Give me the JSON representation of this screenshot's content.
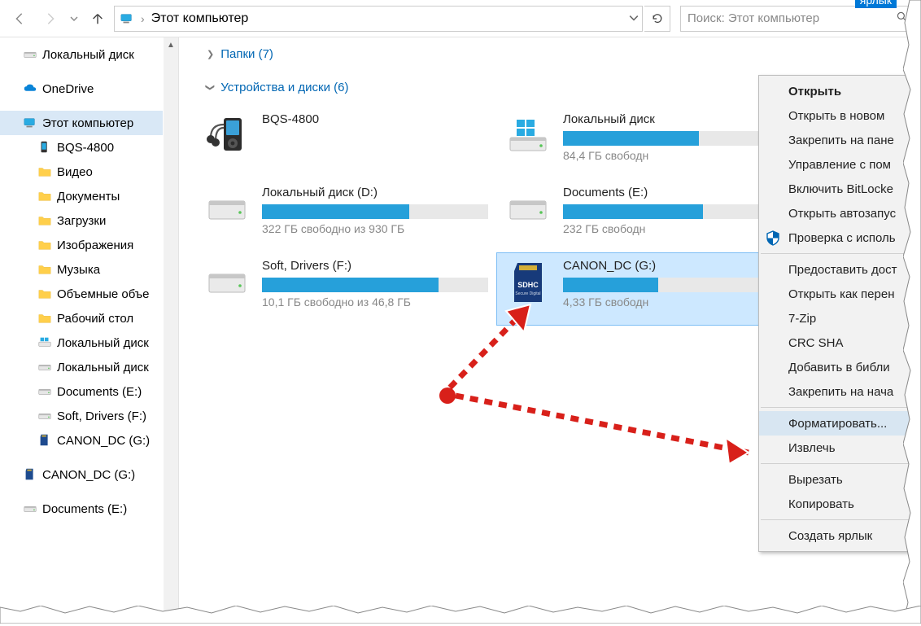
{
  "nav": {
    "breadcrumb": "Этот компьютер",
    "search_placeholder": "Поиск: Этот компьютер"
  },
  "sidebar": {
    "items": [
      {
        "label": "Локальный диск",
        "icon": "drive"
      },
      {
        "spacer": true
      },
      {
        "label": "OneDrive",
        "icon": "onedrive"
      },
      {
        "spacer": true
      },
      {
        "label": "Этот компьютер",
        "icon": "pc",
        "selected": true
      },
      {
        "label": "BQS-4800",
        "icon": "phone",
        "child": true
      },
      {
        "label": "Видео",
        "icon": "folder-video",
        "child": true
      },
      {
        "label": "Документы",
        "icon": "folder-docs",
        "child": true
      },
      {
        "label": "Загрузки",
        "icon": "folder-down",
        "child": true
      },
      {
        "label": "Изображения",
        "icon": "folder-img",
        "child": true
      },
      {
        "label": "Музыка",
        "icon": "folder-music",
        "child": true
      },
      {
        "label": "Объемные объе",
        "icon": "folder-3d",
        "child": true
      },
      {
        "label": "Рабочий стол",
        "icon": "folder-desk",
        "child": true
      },
      {
        "label": "Локальный диск",
        "icon": "drive-win",
        "child": true
      },
      {
        "label": "Локальный диск",
        "icon": "drive",
        "child": true
      },
      {
        "label": "Documents (E:)",
        "icon": "drive",
        "child": true
      },
      {
        "label": "Soft, Drivers (F:)",
        "icon": "drive",
        "child": true
      },
      {
        "label": "CANON_DC (G:)",
        "icon": "sd-sm",
        "child": true
      },
      {
        "spacer": true
      },
      {
        "label": "CANON_DC (G:)",
        "icon": "sd-sm"
      },
      {
        "spacer": true
      },
      {
        "label": "Documents (E:)",
        "icon": "drive"
      }
    ]
  },
  "groups": {
    "folders_label": "Папки (7)",
    "devices_label": "Устройства и диски (6)"
  },
  "drives": [
    {
      "name": "BQS-4800",
      "icon": "mp3",
      "no_bar": true
    },
    {
      "name": "Локальный диск",
      "icon": "drive-win",
      "fill": 60,
      "free": "84,4 ГБ свободн"
    },
    {
      "name": "Локальный диск (D:)",
      "icon": "drive",
      "fill": 65,
      "free": "322 ГБ свободно из 930 ГБ"
    },
    {
      "name": "Documents (E:)",
      "icon": "drive",
      "fill": 62,
      "free": "232 ГБ свободн"
    },
    {
      "name": "Soft, Drivers (F:)",
      "icon": "drive",
      "fill": 78,
      "free": "10,1 ГБ свободно из 46,8 ГБ"
    },
    {
      "name": "CANON_DC (G:)",
      "icon": "sd",
      "fill": 42,
      "free": "4,33 ГБ свободн",
      "selected": true
    }
  ],
  "context_menu": [
    {
      "label": "Открыть",
      "bold": true
    },
    {
      "label": "Открыть в новом "
    },
    {
      "label": "Закрепить на пане"
    },
    {
      "label": "Управление с пом"
    },
    {
      "label": "Включить BitLocke"
    },
    {
      "label": "Открыть автозапус"
    },
    {
      "label": "Проверка с исполь",
      "icon": "shield"
    },
    {
      "sep": true
    },
    {
      "label": "Предоставить дост"
    },
    {
      "label": "Открыть как перен"
    },
    {
      "label": "7-Zip"
    },
    {
      "label": "CRC SHA"
    },
    {
      "label": "Добавить в библи"
    },
    {
      "label": "Закрепить на нача"
    },
    {
      "sep": true
    },
    {
      "label": "Форматировать...",
      "hl": true
    },
    {
      "label": "Извлечь"
    },
    {
      "sep": true
    },
    {
      "label": "Вырезать"
    },
    {
      "label": "Копировать"
    },
    {
      "sep": true
    },
    {
      "label": "Создать ярлык"
    }
  ],
  "shortcut_hint": "ярлык"
}
